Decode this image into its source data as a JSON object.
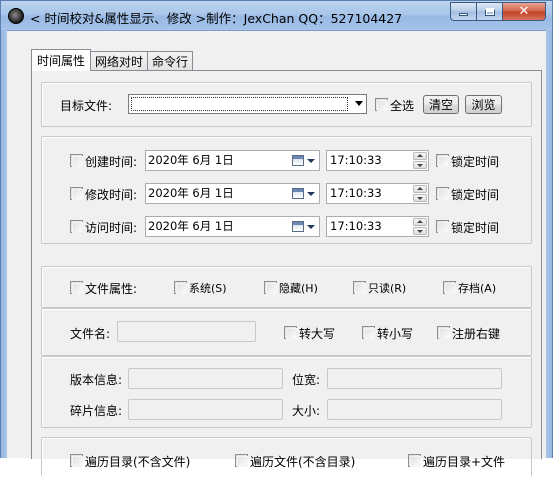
{
  "window": {
    "title": "< 时间校对&属性显示、修改 >制作：JexChan  QQ：527104427",
    "close_glyph": "✕"
  },
  "tabs": [
    {
      "label": "时间属性",
      "active": true
    },
    {
      "label": "网络对时",
      "active": false
    },
    {
      "label": "命令行",
      "active": false
    }
  ],
  "target": {
    "label": "目标文件:",
    "select_all": "全选",
    "clear_button": "清空",
    "browse_button": "浏览"
  },
  "times": {
    "created": {
      "label": "创建时间:",
      "date": "2020年 6月 1日",
      "time": "17:10:33",
      "lock": "锁定时间"
    },
    "modified": {
      "label": "修改时间:",
      "date": "2020年 6月 1日",
      "time": "17:10:33",
      "lock": "锁定时间"
    },
    "accessed": {
      "label": "访问时间:",
      "date": "2020年 6月 1日",
      "time": "17:10:33",
      "lock": "锁定时间"
    }
  },
  "attributes": {
    "label": "文件属性:",
    "system": "系统(S)",
    "hidden": "隐藏(H)",
    "readonly": "只读(R)",
    "archive": "存档(A)"
  },
  "filename": {
    "label": "文件名:",
    "upper": "转大写",
    "lower": "转小写",
    "context_menu": "注册右键"
  },
  "info": {
    "version": "版本信息:",
    "bitness": "位宽:",
    "fragments": "碎片信息:",
    "size": "大小:"
  },
  "traverse": {
    "dirs_only": "遍历目录(不含文件)",
    "files_only": "遍历文件(不含目录)",
    "dirs_and_files": "遍历目录+文件"
  }
}
